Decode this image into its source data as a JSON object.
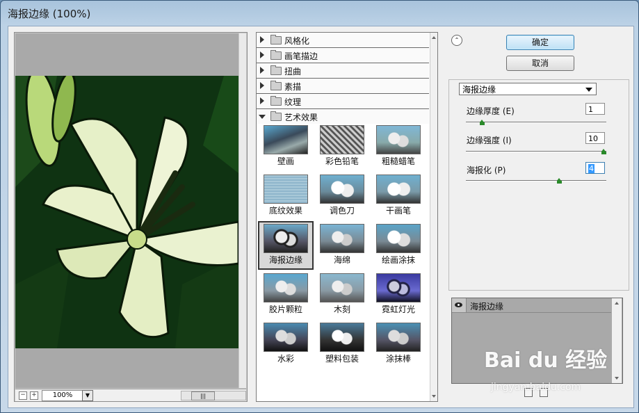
{
  "window": {
    "title": "海报边缘 (100%)"
  },
  "preview": {
    "zoom": "100%",
    "zoom_out": "−",
    "zoom_in": "+",
    "scroll_thumb": "|||"
  },
  "gallery": {
    "categories": [
      {
        "label": "风格化",
        "open": false
      },
      {
        "label": "画笔描边",
        "open": false
      },
      {
        "label": "扭曲",
        "open": false
      },
      {
        "label": "素描",
        "open": false
      },
      {
        "label": "纹理",
        "open": false
      },
      {
        "label": "艺术效果",
        "open": true
      }
    ],
    "thumbnails": [
      {
        "label": "壁画"
      },
      {
        "label": "彩色铅笔"
      },
      {
        "label": "粗糙蜡笔"
      },
      {
        "label": "底纹效果"
      },
      {
        "label": "调色刀"
      },
      {
        "label": "干画笔"
      },
      {
        "label": "海报边缘",
        "selected": true
      },
      {
        "label": "海绵"
      },
      {
        "label": "绘画涂抹"
      },
      {
        "label": "胶片颗粒"
      },
      {
        "label": "木刻"
      },
      {
        "label": "霓虹灯光"
      },
      {
        "label": "水彩"
      },
      {
        "label": "塑料包装"
      },
      {
        "label": "涂抹棒"
      }
    ]
  },
  "actions": {
    "ok_label": "确定",
    "cancel_label": "取消"
  },
  "filter_settings": {
    "selected_filter": "海报边缘",
    "params": [
      {
        "label": "边缘厚度 (E)",
        "value": "1",
        "level": 0.1
      },
      {
        "label": "边缘强度 (I)",
        "value": "10",
        "level": 1.0
      },
      {
        "label": "海报化 (P)",
        "value": "4",
        "level": 0.67
      }
    ]
  },
  "layers": {
    "items": [
      {
        "label": "海报边缘"
      }
    ]
  },
  "watermark": {
    "brand": "Bai du 经验",
    "url": "jingyan.baidu.com"
  },
  "colors": {
    "dialog_bg": "#f0f0f0",
    "title_bar": "#bcd2e6",
    "default_button": "#bfe0f5",
    "slider_knob": "#2a8a2a"
  }
}
